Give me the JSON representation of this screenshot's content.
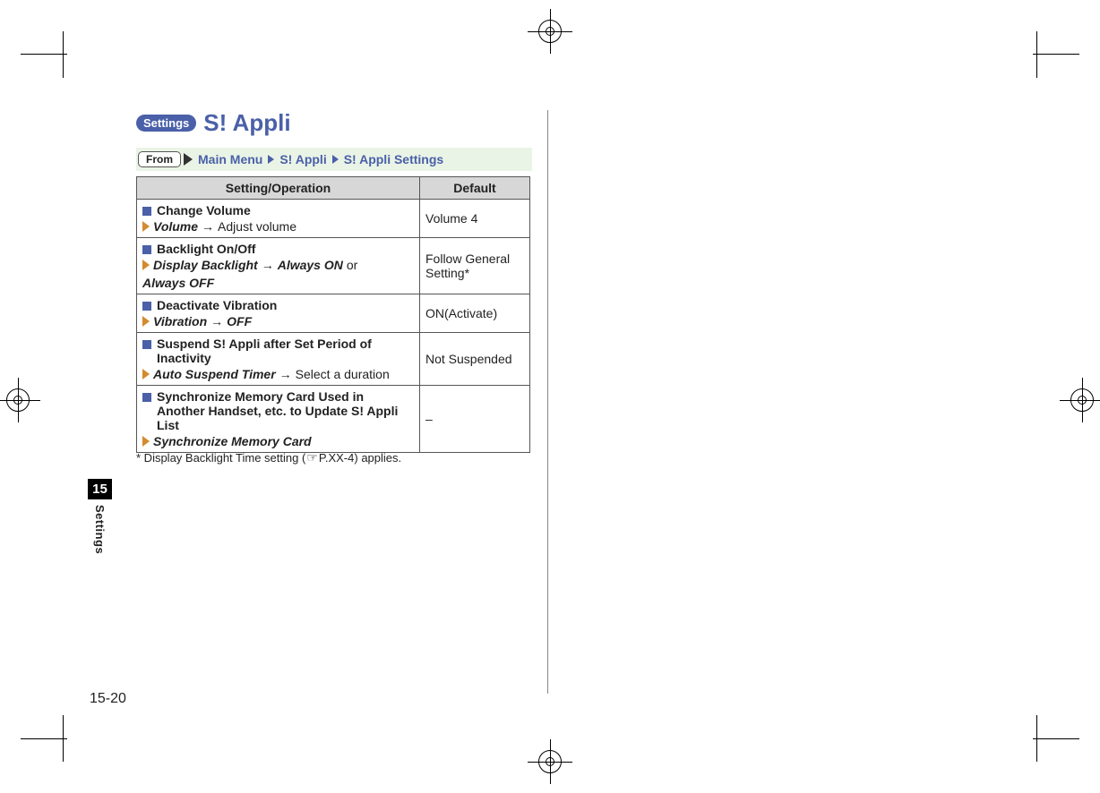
{
  "heading": {
    "pill": "Settings",
    "title": "S! Appli"
  },
  "breadcrumb": {
    "from_label": "From",
    "items": [
      "Main Menu",
      "S! Appli",
      "S! Appli Settings"
    ]
  },
  "table": {
    "headers": {
      "setting": "Setting/Operation",
      "default": "Default"
    },
    "rows": [
      {
        "title": "Change Volume",
        "path_primary": "Volume",
        "path_after": "Adjust volume",
        "path_variant": "",
        "path_connector": "",
        "path_option_b": "",
        "default": "Volume 4",
        "default_center": false
      },
      {
        "title": "Backlight On/Off",
        "path_primary": "Display Backlight",
        "path_after": "",
        "path_variant": "Always ON",
        "path_connector": "or",
        "path_option_b": "Always OFF",
        "default": "Follow General Setting*",
        "default_center": false
      },
      {
        "title": "Deactivate Vibration",
        "path_primary": "Vibration",
        "path_after": "",
        "path_variant": "OFF",
        "path_connector": "",
        "path_option_b": "",
        "default": "ON(Activate)",
        "default_center": false
      },
      {
        "title": "Suspend S! Appli after Set Period of Inactivity",
        "path_primary": "Auto Suspend Timer",
        "path_after": "Select a duration",
        "path_variant": "",
        "path_connector": "",
        "path_option_b": "",
        "default": "Not Suspended",
        "default_center": false
      },
      {
        "title": "Synchronize Memory Card Used in Another Handset, etc. to Update S! Appli List",
        "path_primary": "Synchronize Memory Card",
        "path_after": "",
        "path_variant": "",
        "path_connector": "",
        "path_option_b": "",
        "default": "–",
        "default_center": true
      }
    ]
  },
  "footnote": {
    "mark": "*",
    "pre": " Display Backlight Time setting (",
    "ref": "P.XX-4",
    "post": ") applies."
  },
  "side_tab": {
    "chapter": "15",
    "label": "Settings"
  },
  "page_number": "15-20"
}
